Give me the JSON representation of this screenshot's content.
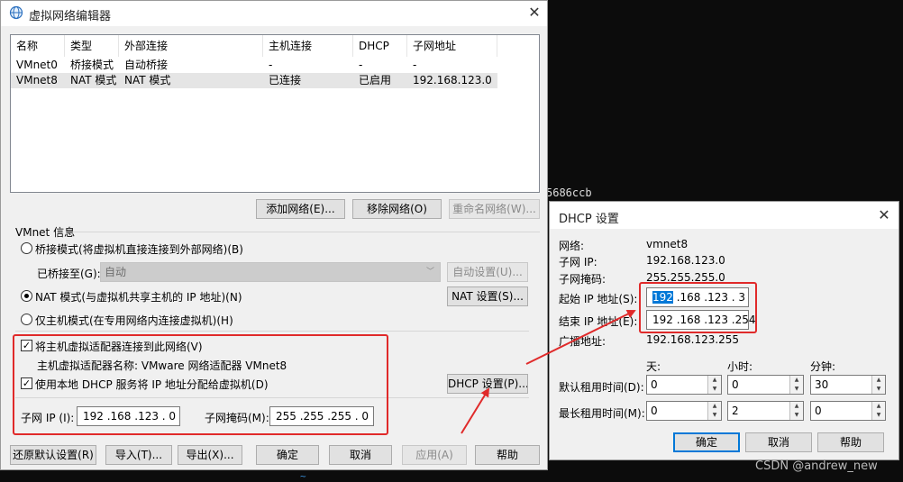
{
  "bg_console": {
    "fragment": "5686ccb",
    "watermark": "CSDN @andrew_new",
    "tilde": "~"
  },
  "vne": {
    "title": "虚拟网络编辑器",
    "columns": [
      "名称",
      "类型",
      "外部连接",
      "主机连接",
      "DHCP",
      "子网地址"
    ],
    "rows": [
      [
        "VMnet0",
        "桥接模式",
        "自动桥接",
        "-",
        "-",
        "-"
      ],
      [
        "VMnet8",
        "NAT 模式",
        "NAT 模式",
        "已连接",
        "已启用",
        "192.168.123.0"
      ]
    ],
    "selected_row": 1,
    "add_network": "添加网络(E)...",
    "remove_network": "移除网络(O)",
    "rename_network": "重命名网络(W)...",
    "group_label": "VMnet 信息",
    "bridged_label": "桥接模式(将虚拟机直接连接到外部网络)(B)",
    "bridged_to_label": "已桥接至(G):",
    "bridged_to_value": "自动",
    "auto_settings": "自动设置(U)...",
    "nat_label": "NAT 模式(与虚拟机共享主机的 IP 地址)(N)",
    "nat_settings": "NAT 设置(S)...",
    "hostonly_label": "仅主机模式(在专用网络内连接虚拟机)(H)",
    "selected_mode": "nat",
    "connect_adapter_label": "将主机虚拟适配器连接到此网络(V)",
    "adapter_name_line": "主机虚拟适配器名称: VMware 网络适配器 VMnet8",
    "use_dhcp_label": "使用本地 DHCP 服务将 IP 地址分配给虚拟机(D)",
    "dhcp_settings": "DHCP 设置(P)...",
    "subnet_ip_label": "子网 IP (I):",
    "subnet_ip": "192 .168 .123 .  0",
    "subnet_mask_label": "子网掩码(M):",
    "subnet_mask": "255 .255 .255 .  0",
    "restore_defaults": "还原默认设置(R)",
    "import": "导入(T)...",
    "export": "导出(X)...",
    "ok": "确定",
    "cancel": "取消",
    "apply": "应用(A)",
    "help": "帮助"
  },
  "dhcp": {
    "title": "DHCP 设置",
    "network_label": "网络:",
    "network_value": "vmnet8",
    "subnet_ip_label": "子网 IP:",
    "subnet_ip_value": "192.168.123.0",
    "subnet_mask_label": "子网掩码:",
    "subnet_mask_value": "255.255.255.0",
    "start_ip_label": "起始 IP 地址(S):",
    "start_ip_selected": "192",
    "start_ip_rest": " .168 .123 .  3",
    "end_ip_label": "结束 IP 地址(E):",
    "end_ip_value": "192 .168 .123 .254",
    "broadcast_label": "广播地址:",
    "broadcast_value": "192.168.123.255",
    "day_header": "天:",
    "hour_header": "小时:",
    "minute_header": "分钟:",
    "default_lease_label": "默认租用时间(D):",
    "default_lease": [
      "0",
      "0",
      "30"
    ],
    "max_lease_label": "最长租用时间(M):",
    "max_lease": [
      "0",
      "2",
      "0"
    ],
    "ok": "确定",
    "cancel": "取消",
    "help": "帮助"
  },
  "colors": {
    "annotation_red": "#e02a2a",
    "selection_blue": "#0078d7"
  },
  "icons": [
    "network-globe-icon",
    "close-icon",
    "dropdown-arrow-icon",
    "spin-up-icon",
    "spin-down-icon"
  ]
}
